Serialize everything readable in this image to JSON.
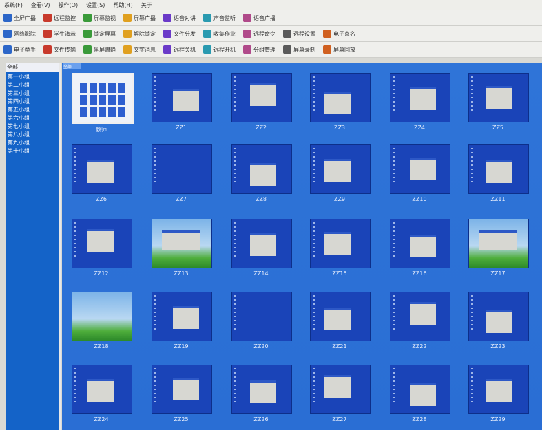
{
  "menu": [
    "系统(F)",
    "查看(V)",
    "操作(O)",
    "设置(S)",
    "帮助(H)",
    "关于"
  ],
  "toolbar1": [
    "全屏广播",
    "远程监控",
    "屏幕监视",
    "屏幕广播",
    "语音对讲",
    "声音监听",
    "语音广播"
  ],
  "toolbar2": [
    "网络影院",
    "学生演示",
    "锁定屏幕",
    "解除锁定",
    "文件分发",
    "收集作业",
    "远程命令",
    "远程设置",
    "电子点名"
  ],
  "toolbar3": [
    "电子举手",
    "文件传输",
    "黑屏肃静",
    "文字消息",
    "远程关机",
    "远程开机",
    "分组管理",
    "屏幕录制",
    "屏幕回放"
  ],
  "sidebar": {
    "header": "全部",
    "items": [
      "第一小组",
      "第二小组",
      "第三小组",
      "第四小组",
      "第五小组",
      "第六小组",
      "第七小组",
      "第八小组",
      "第九小组",
      "第十小组"
    ]
  },
  "main_tab": "全部",
  "tiles": [
    {
      "label": "教师",
      "style": "teacher"
    },
    {
      "label": "ZZ1",
      "style": "win"
    },
    {
      "label": "ZZ2",
      "style": "win"
    },
    {
      "label": "ZZ3",
      "style": "win"
    },
    {
      "label": "ZZ4",
      "style": "win"
    },
    {
      "label": "ZZ5",
      "style": "win"
    },
    {
      "label": "ZZ6",
      "style": "win"
    },
    {
      "label": "ZZ7",
      "style": "empty"
    },
    {
      "label": "ZZ8",
      "style": "win"
    },
    {
      "label": "ZZ9",
      "style": "win"
    },
    {
      "label": "ZZ10",
      "style": "win"
    },
    {
      "label": "ZZ11",
      "style": "win"
    },
    {
      "label": "ZZ12",
      "style": "win"
    },
    {
      "label": "ZZ13",
      "style": "skywin"
    },
    {
      "label": "ZZ14",
      "style": "win"
    },
    {
      "label": "ZZ15",
      "style": "win"
    },
    {
      "label": "ZZ16",
      "style": "win"
    },
    {
      "label": "ZZ17",
      "style": "skywin"
    },
    {
      "label": "ZZ18",
      "style": "sky"
    },
    {
      "label": "ZZ19",
      "style": "win"
    },
    {
      "label": "ZZ20",
      "style": "empty"
    },
    {
      "label": "ZZ21",
      "style": "win"
    },
    {
      "label": "ZZ22",
      "style": "win"
    },
    {
      "label": "ZZ23",
      "style": "win"
    },
    {
      "label": "ZZ24",
      "style": "win"
    },
    {
      "label": "ZZ25",
      "style": "win"
    },
    {
      "label": "ZZ26",
      "style": "win"
    },
    {
      "label": "ZZ27",
      "style": "win"
    },
    {
      "label": "ZZ28",
      "style": "win"
    },
    {
      "label": "ZZ29",
      "style": "win"
    }
  ],
  "colors": {
    "sidebar": "#1463c8",
    "desktop": "#1a44b8",
    "main": "#2f74d8"
  }
}
